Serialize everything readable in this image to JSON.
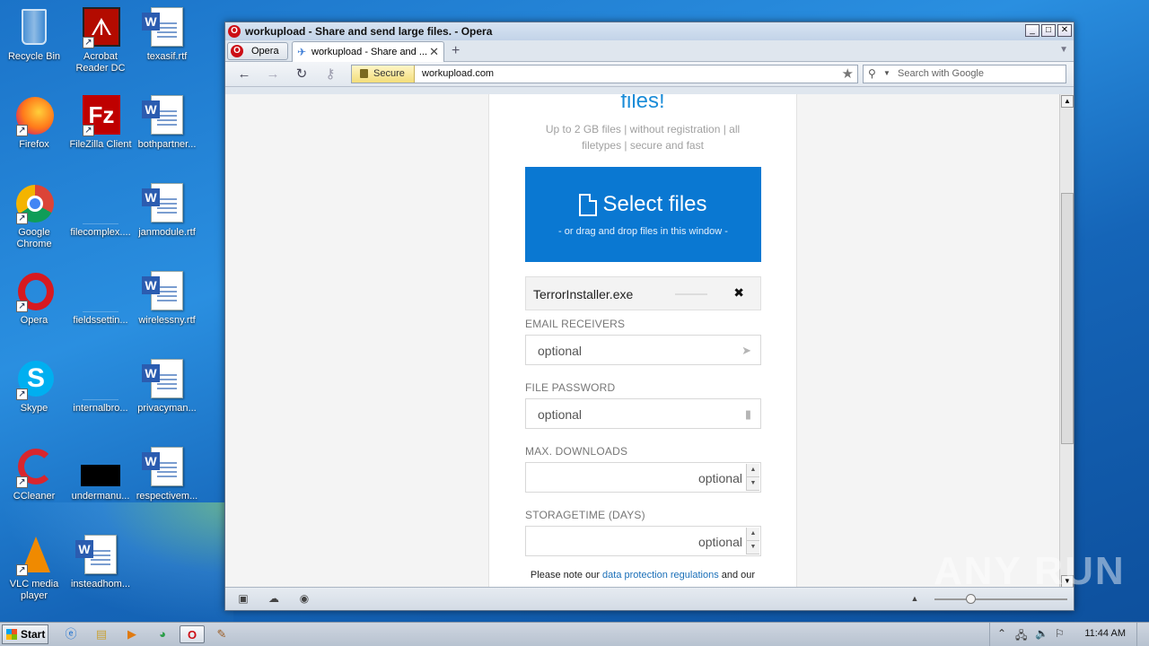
{
  "desktop": {
    "icons": [
      {
        "label": "Recycle Bin"
      },
      {
        "label": "Acrobat Reader DC"
      },
      {
        "label": "texasif.rtf"
      },
      {
        "label": "Firefox"
      },
      {
        "label": "FileZilla Client"
      },
      {
        "label": "bothpartner..."
      },
      {
        "label": "Google Chrome"
      },
      {
        "label": "filecomplex...."
      },
      {
        "label": "janmodule.rtf"
      },
      {
        "label": "Opera"
      },
      {
        "label": "fieldssettin..."
      },
      {
        "label": "wirelessny.rtf"
      },
      {
        "label": "Skype"
      },
      {
        "label": "internalbro..."
      },
      {
        "label": "privacyman..."
      },
      {
        "label": "CCleaner"
      },
      {
        "label": "undermanu..."
      },
      {
        "label": "respectivem..."
      },
      {
        "label": "VLC media player"
      },
      {
        "label": "insteadhom..."
      }
    ],
    "watermark": "ANY RUN"
  },
  "window": {
    "title": "workupload - Share and send large files. - Opera",
    "controls": {
      "minimize": "_",
      "maximize": "□",
      "close": "✕"
    }
  },
  "tabs": {
    "menu_label": "Opera",
    "active_tab": "workupload - Share and ...",
    "close_glyph": "✕",
    "new_tab_glyph": "+"
  },
  "navbar": {
    "secure_label": "Secure",
    "url": "workupload.com",
    "search_placeholder": "Search with Google"
  },
  "page": {
    "hero_tail": "files!",
    "subtitle": "Up to 2 GB files | without registration | all filetypes | secure and fast",
    "select_files": "Select files",
    "drop_hint": "- or drag and drop files in this window -",
    "file_name": "TerrorInstaller.exe",
    "remove_glyph": "✖",
    "fields": [
      {
        "label": "EMAIL RECEIVERS",
        "placeholder": "optional"
      },
      {
        "label": "FILE PASSWORD",
        "placeholder": "optional"
      },
      {
        "label": "MAX. DOWNLOADS",
        "placeholder": "optional"
      },
      {
        "label": "STORAGETIME (DAYS)",
        "placeholder": "optional"
      }
    ],
    "note_prefix": "Please note our",
    "note_link": "data protection regulations",
    "note_suffix": "and our"
  },
  "taskbar": {
    "start_label": "Start",
    "clock": "11:44 AM"
  },
  "colors": {
    "accent_blue": "#0a78d2",
    "hero_blue": "#1a8cd8",
    "opera_red": "#cc0f16"
  }
}
